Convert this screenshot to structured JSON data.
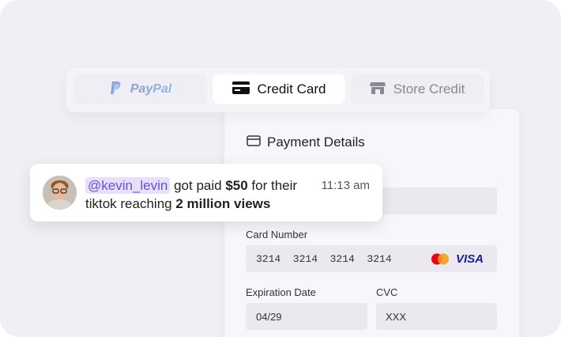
{
  "tabs": {
    "paypal": {
      "label_pay": "Pay",
      "label_pal": "Pal"
    },
    "credit_card": {
      "label": "Credit Card"
    },
    "store_credit": {
      "label": "Store Credit"
    }
  },
  "payment": {
    "title": "Payment Details",
    "card_number_label": "Card Number",
    "card_number": "3214  3214  3214  3214",
    "visa_label": "VISA",
    "expiration_label": "Expiration Date",
    "expiration_value": "04/29",
    "cvc_label": "CVC",
    "cvc_value": "XXX"
  },
  "notification": {
    "mention": "@kevin_levin",
    "text_part1": " got paid ",
    "amount": "$50",
    "text_part2": " for their",
    "text_line2": "tiktok reaching ",
    "views": "2 million views",
    "time": "11:13 am"
  },
  "colors": {
    "background": "#f0eff4",
    "mention_bg": "#e6e0fb",
    "mention_text": "#6b4fd8",
    "visa_blue": "#1a1f9c",
    "mastercard_red": "#eb001b",
    "mastercard_orange": "#f79e1b"
  },
  "icons": [
    "paypal-logo-icon",
    "credit-card-icon",
    "store-icon",
    "card-outline-icon",
    "mastercard-logo-icon",
    "visa-logo-icon"
  ]
}
